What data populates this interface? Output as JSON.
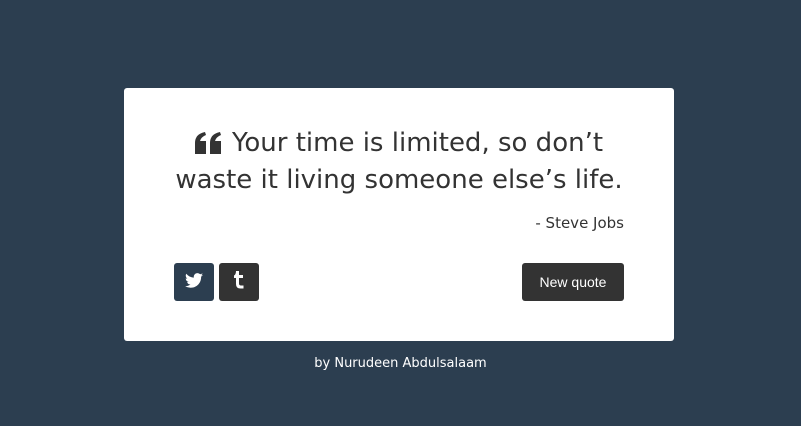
{
  "quote": {
    "text": "Your time is limited, so don’t waste it living someone else’s life.",
    "author": "- Steve Jobs",
    "icon": "quote-left-icon"
  },
  "actions": {
    "twitter_icon": "twitter-icon",
    "tumblr_icon": "tumblr-icon",
    "new_quote_label": "New quote"
  },
  "footer": {
    "credit": "by Nurudeen Abdulsalaam"
  },
  "colors": {
    "background": "#2c3e50",
    "card": "#ffffff",
    "text": "#333333",
    "twitter_button": "#2c3e50",
    "tumblr_button": "#333333",
    "new_quote_button": "#333333"
  }
}
